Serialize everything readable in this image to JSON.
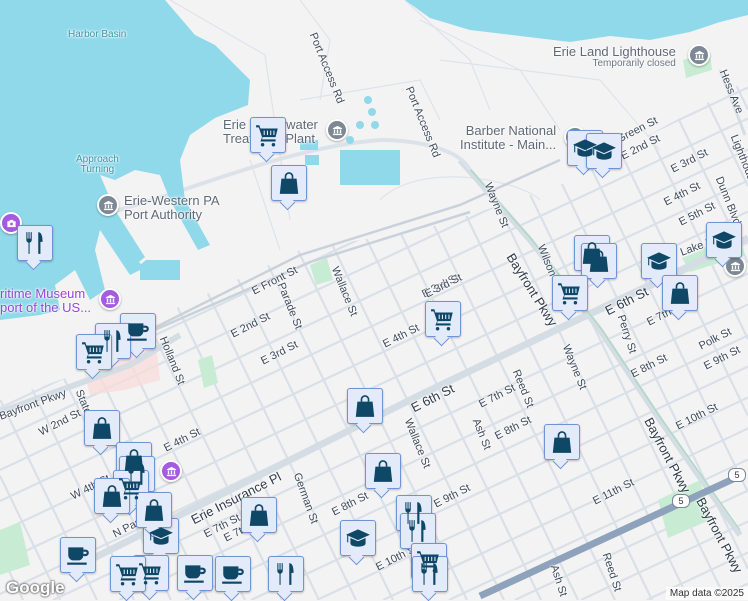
{
  "colors": {
    "water": "#8fd9ea",
    "land": "#f4f3f4",
    "park": "#c7ecd3",
    "road": "#d7dee6",
    "highway": "#8ea2bc",
    "marker_bg": "#e3ebfb",
    "marker_icon": "#0f4767",
    "museum": "#a55be0"
  },
  "water_labels": {
    "harbor_basin": "Harbor Basin",
    "approach_1": "Approach",
    "approach_2": "Turning"
  },
  "pois": {
    "port_authority_1": "Erie-Western PA",
    "port_authority_2": "Port Authority",
    "treatment_1": "Erie Wastewater",
    "treatment_2": "Treatment Plant",
    "lighthouse": "Erie Land Lighthouse",
    "lighthouse_status": "Temporarily closed",
    "barber_1": "Barber National",
    "barber_2": "Institute - Main...",
    "museum_1": "ritime Museum",
    "museum_2": "port of the US..."
  },
  "streets": [
    "Port Access Rd",
    "Port Access Rd",
    "E Front St",
    "Parade St",
    "Wallace St",
    "E 2nd St",
    "E 3rd St",
    "Holland St",
    "E 3rd St",
    "E 4th St",
    "E 6th St",
    "E 7th St",
    "E 8th St",
    "Ash St",
    "Reed St",
    "Wallace St",
    "Wayne St",
    "Wilson St",
    "E 3rd St",
    "E 3rd St",
    "E 2nd St",
    "Green St",
    "E 4th St",
    "E 5th St",
    "Dunn Blvd",
    "Lake Rd",
    "Hess Ave",
    "Lighthouse St",
    "Bayfront Pkwy",
    "Bayfront Pkwy",
    "Bayfront Pkwy",
    "E 6th St",
    "E 7th St",
    "Perry St",
    "Polk St",
    "E 9th St",
    "E 8th St",
    "E 10th St",
    "E 11th St",
    "Reed St",
    "Ash St",
    "Wayne St",
    "E 9th St",
    "E 10th St",
    "German St",
    "E 8th St",
    "E 7th St",
    "W 2nd St",
    "State St",
    "Bayfront Pkwy",
    "W 4th St",
    "E 4th St",
    "N Park Row",
    "Erie Insurance Pl",
    "E 7th St",
    "E 10th St"
  ],
  "route_shields": [
    "5",
    "5"
  ],
  "markers": [
    "cart",
    "bag",
    "fork",
    "grad",
    "grad",
    "bag",
    "bag",
    "grad",
    "bag",
    "grad",
    "cart",
    "cart",
    "cup",
    "fork",
    "cart",
    "bag",
    "bag",
    "fork",
    "cart",
    "bag",
    "grad",
    "cup",
    "cart",
    "cup",
    "cup",
    "fork",
    "cart",
    "bag",
    "grad",
    "bag",
    "bag",
    "fork",
    "fork",
    "cart",
    "fork",
    "bag",
    "bag"
  ],
  "footer": {
    "logo": "Google",
    "attribution": "Map data ©2025"
  }
}
